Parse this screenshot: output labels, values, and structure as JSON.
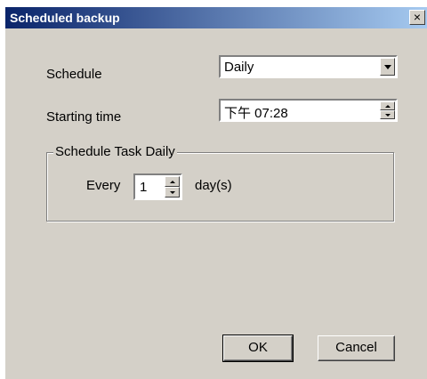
{
  "window": {
    "title": "Scheduled backup",
    "close_label": "×"
  },
  "schedule": {
    "label": "Schedule",
    "value": "Daily"
  },
  "starting_time": {
    "label": "Starting time",
    "value": "下午 07:28"
  },
  "group": {
    "legend": "Schedule Task Daily",
    "every_label": "Every",
    "every_value": "1",
    "unit_label": "day(s)"
  },
  "buttons": {
    "ok": "OK",
    "cancel": "Cancel"
  }
}
